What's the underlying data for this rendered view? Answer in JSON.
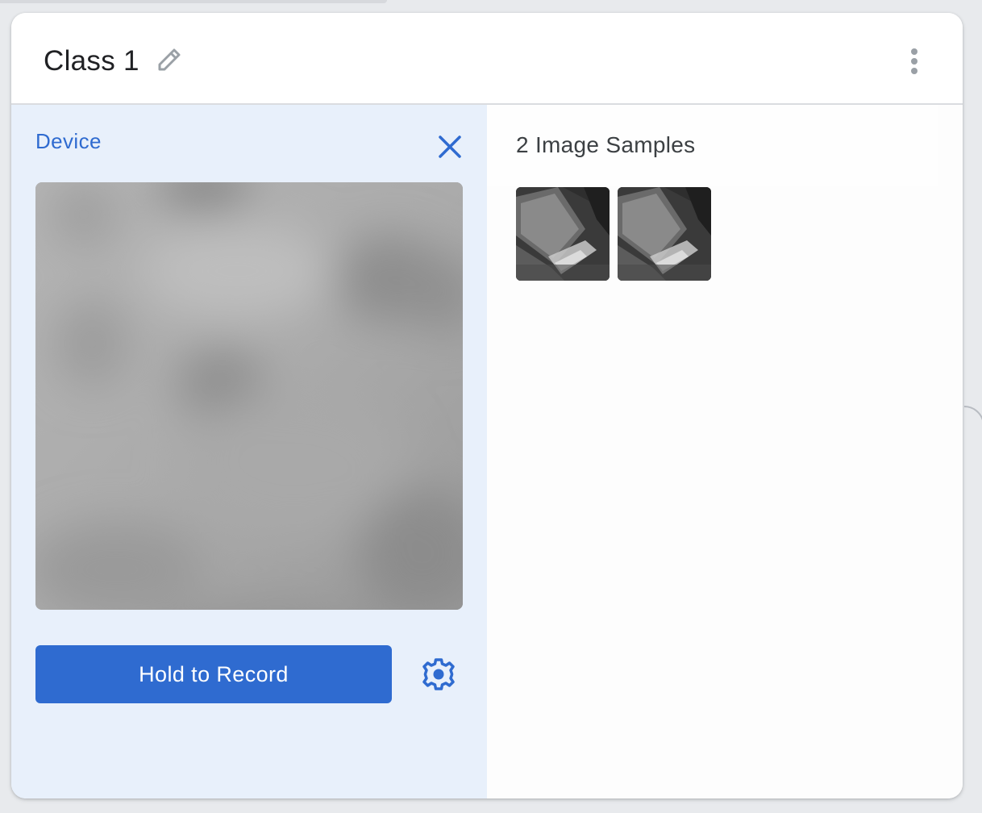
{
  "header": {
    "class_name": "Class 1",
    "edit_icon": "pencil-icon",
    "menu_icon": "more-vert-icon"
  },
  "capture": {
    "source_label": "Device",
    "close_icon": "close-icon",
    "record_label": "Hold to Record",
    "settings_icon": "gear-icon"
  },
  "samples": {
    "count_label": "2 Image Samples",
    "thumbnails": [
      "sample-1",
      "sample-2"
    ]
  },
  "colors": {
    "accent": "#2f6bd0",
    "panel_bg": "#e8f0fb",
    "page_bg": "#e8eaed"
  }
}
